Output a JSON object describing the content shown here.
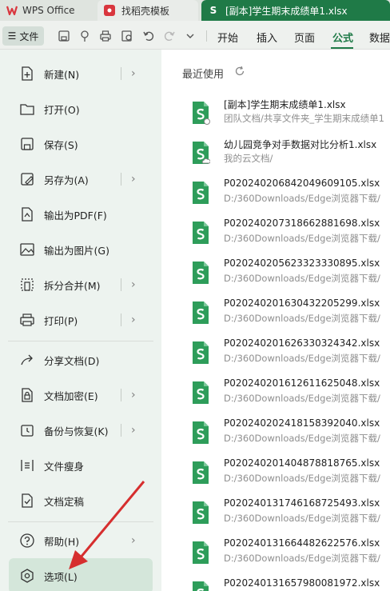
{
  "tabs": {
    "wps": "WPS Office",
    "template": "找稻壳模板",
    "document": "[副本]学生期末成绩单1.xlsx"
  },
  "menubar": {
    "file": "文件",
    "items": [
      "开始",
      "插入",
      "页面",
      "公式",
      "数据"
    ],
    "active": "公式"
  },
  "leftmenu": [
    {
      "label": "新建(N)",
      "icon": "new-file-icon",
      "chevron": true
    },
    {
      "label": "打开(O)",
      "icon": "open-folder-icon",
      "chevron": false
    },
    {
      "label": "保存(S)",
      "icon": "save-icon",
      "chevron": false
    },
    {
      "label": "另存为(A)",
      "icon": "save-as-icon",
      "chevron": true
    },
    {
      "label": "输出为PDF(F)",
      "icon": "export-pdf-icon",
      "chevron": false
    },
    {
      "label": "输出为图片(G)",
      "icon": "export-image-icon",
      "chevron": false
    },
    {
      "label": "拆分合并(M)",
      "icon": "split-merge-icon",
      "chevron": true
    },
    {
      "label": "打印(P)",
      "icon": "print-icon",
      "chevron": true
    },
    {
      "label": "分享文档(D)",
      "icon": "share-icon",
      "chevron": false
    },
    {
      "label": "文档加密(E)",
      "icon": "lock-icon",
      "chevron": true
    },
    {
      "label": "备份与恢复(K)",
      "icon": "backup-icon",
      "chevron": true
    },
    {
      "label": "文件瘦身",
      "icon": "slim-icon",
      "chevron": false
    },
    {
      "label": "文档定稿",
      "icon": "finalize-icon",
      "chevron": false
    },
    {
      "label": "帮助(H)",
      "icon": "help-icon",
      "chevron": true
    },
    {
      "label": "选项(L)",
      "icon": "settings-icon",
      "chevron": false,
      "selected": true
    }
  ],
  "recent": {
    "title": "最近使用",
    "files": [
      {
        "name": "[副本]学生期末成绩单1.xlsx",
        "path": "团队文档/共享文件夹_学生期末成绩单1"
      },
      {
        "name": "幼儿园竞争对手数据对比分析1.xlsx",
        "path": "我的云文档/"
      },
      {
        "name": "P020240206842049609105.xlsx",
        "path": "D:/360Downloads/Edge浏览器下载/"
      },
      {
        "name": "P020240207318662881698.xlsx",
        "path": "D:/360Downloads/Edge浏览器下载/"
      },
      {
        "name": "P020240205623323330895.xlsx",
        "path": "D:/360Downloads/Edge浏览器下载/"
      },
      {
        "name": "P020240201630432205299.xlsx",
        "path": "D:/360Downloads/Edge浏览器下载/"
      },
      {
        "name": "P020240201626330324342.xlsx",
        "path": "D:/360Downloads/Edge浏览器下载/"
      },
      {
        "name": "P020240201612611625048.xlsx",
        "path": "D:/360Downloads/Edge浏览器下载/"
      },
      {
        "name": "P020240202418158392040.xlsx",
        "path": "D:/360Downloads/Edge浏览器下载/"
      },
      {
        "name": "P020240201404878818765.xlsx",
        "path": "D:/360Downloads/Edge浏览器下载/"
      },
      {
        "name": "P020240131746168725493.xlsx",
        "path": "D:/360Downloads/Edge浏览器下载/"
      },
      {
        "name": "P020240131664482622576.xlsx",
        "path": "D:/360Downloads/Edge浏览器下载/"
      },
      {
        "name": "P020240131657980081972.xlsx",
        "path": ""
      }
    ]
  },
  "colors": {
    "accent": "#1f7a47",
    "file_icon": "#2e9d5a",
    "annotation_arrow": "#d62e2e"
  }
}
